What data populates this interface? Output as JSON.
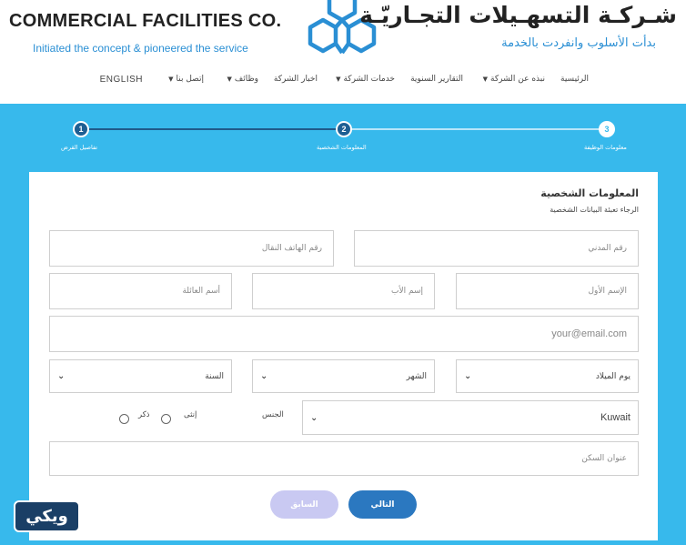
{
  "header": {
    "company_en": "COMMERCIAL FACILITIES CO.",
    "slogan_en": "Initiated the concept & pioneered the service",
    "company_ar": "شـركـة التسهـيلات التجـاريّـة",
    "slogan_ar": "بدأت الأسلوب وانفردت بالخدمة"
  },
  "nav": {
    "home": "الرئيسية",
    "about": "نبذه عن الشركة",
    "reports": "التقارير السنوية",
    "services": "خدمات الشركة",
    "news": "اخبار الشركة",
    "jobs": "وظائف",
    "contact": "إتصل بنا",
    "language": "ENGLISH"
  },
  "steps": [
    {
      "number": "1",
      "label": "تفاصيل القرض"
    },
    {
      "number": "2",
      "label": "المعلومات الشخصية"
    },
    {
      "number": "3",
      "label": "معلومات الوظيفة"
    }
  ],
  "form": {
    "title": "المعلومات الشخصية",
    "subtitle": "الرجاء تعبئة البيانات الشخصية",
    "civil_id_placeholder": "رقم المدني",
    "mobile_placeholder": "رقم الهاتف النقال",
    "first_name_placeholder": "الإسم الأول",
    "father_name_placeholder": "إسم الأب",
    "family_name_placeholder": "أسم العائلة",
    "email_placeholder": "your@email.com",
    "birth_day": "يوم الميلاد",
    "birth_month": "الشهر",
    "birth_year": "السنة",
    "nationality": "Kuwait",
    "gender_label": "الجنس",
    "gender_female": "إنثى",
    "gender_male": "ذكر",
    "address_placeholder": "عنوان السكن"
  },
  "buttons": {
    "next": "التالي",
    "previous": "السابق"
  },
  "badge": {
    "text": "ويكي"
  }
}
